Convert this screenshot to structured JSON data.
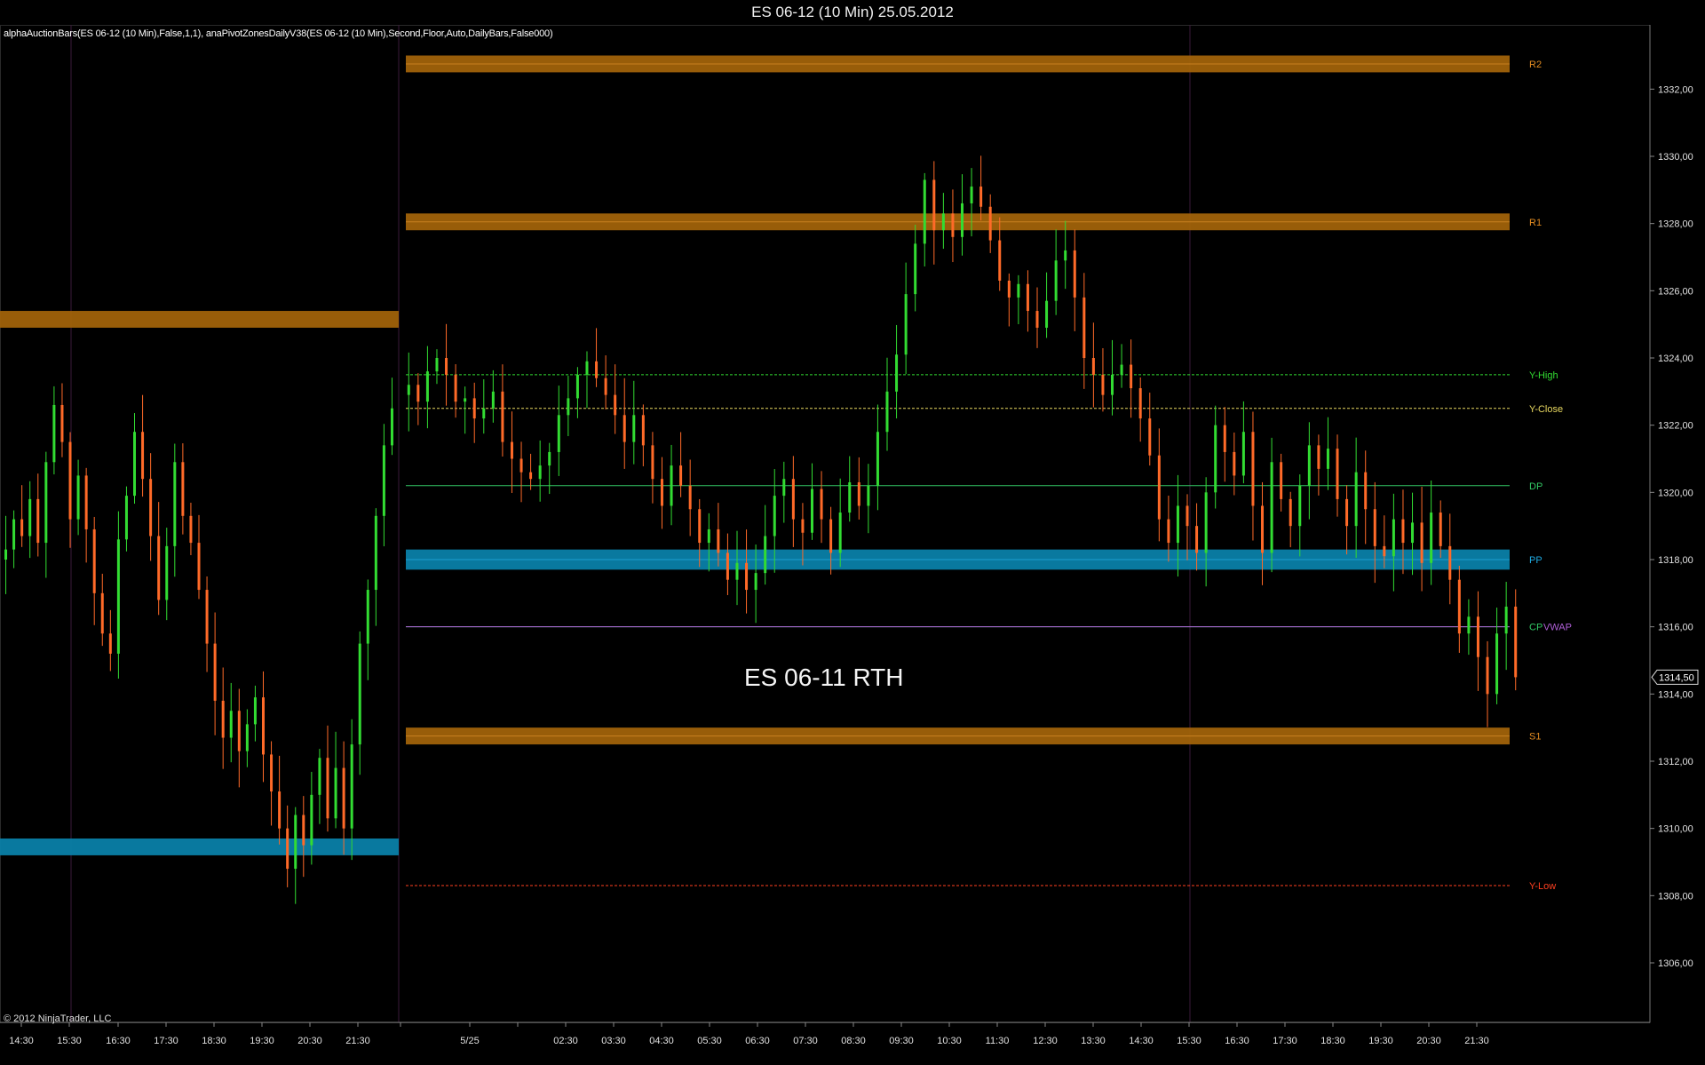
{
  "window": {
    "title": "ES 06-12 (10 Min)  25.05.2012"
  },
  "indicator_label": "alphaAuctionBars(ES 06-12 (10 Min),False,1,1), anaPivotZonesDailyV38(ES 06-12 (10 Min),Second,Floor,Auto,DailyBars,False000)",
  "copyright": "© 2012 NinjaTrader, LLC",
  "annotation": "ES 06-11 RTH",
  "colors": {
    "background": "#000000",
    "up_candle": "#32dc32",
    "down_candle": "#ff6a28",
    "resistance_zone": "#a0620a",
    "pivot_zone": "#0a80a8",
    "axis_text": "#e0e0e0"
  },
  "chart_data": {
    "type": "candlestick",
    "instrument": "ES 06-12",
    "interval": "10 Min",
    "y_axis": {
      "min": 1304,
      "max": 1334,
      "ticks": [
        "1306,00",
        "1308,00",
        "1310,00",
        "1312,00",
        "1314,00",
        "1316,00",
        "1318,00",
        "1320,00",
        "1322,00",
        "1324,00",
        "1326,00",
        "1328,00",
        "1330,00",
        "1332,00"
      ],
      "last_price": "1314,50"
    },
    "x_axis": {
      "ticks": [
        "14:30",
        "15:30",
        "16:30",
        "17:30",
        "18:30",
        "19:30",
        "20:30",
        "21:30",
        "5/25",
        "02:30",
        "03:30",
        "04:30",
        "05:30",
        "06:30",
        "07:30",
        "08:30",
        "09:30",
        "10:30",
        "11:30",
        "12:30",
        "13:30",
        "14:30",
        "15:30",
        "16:30",
        "17:30",
        "18:30",
        "19:30",
        "20:30",
        "21:30"
      ]
    },
    "zones": [
      {
        "name": "R2",
        "low": 1332.5,
        "high": 1333.0,
        "color": "#a0620a"
      },
      {
        "name": "R1",
        "low": 1327.8,
        "high": 1328.3,
        "color": "#a0620a"
      },
      {
        "name": "PP",
        "low": 1317.7,
        "high": 1318.3,
        "color": "#0a80a8"
      },
      {
        "name": "S1",
        "low": 1312.5,
        "high": 1313.0,
        "color": "#a0620a"
      }
    ],
    "prior_zones": [
      {
        "low": 1324.9,
        "high": 1325.4,
        "color": "#a0620a"
      },
      {
        "low": 1309.2,
        "high": 1309.7,
        "color": "#0a80a8"
      }
    ],
    "lines": [
      {
        "name": "Y-High",
        "value": 1323.5,
        "color": "#32dc32",
        "style": "dashed"
      },
      {
        "name": "Y-Close",
        "value": 1322.5,
        "color": "#e8d860",
        "style": "dashed"
      },
      {
        "name": "DP",
        "value": 1320.2,
        "color": "#32c864",
        "style": "solid"
      },
      {
        "name": "CP",
        "value": 1316.0,
        "color": "#32c864",
        "style": "solid"
      },
      {
        "name": "VWAP",
        "value": 1316.0,
        "color": "#b060d8",
        "style": "solid"
      },
      {
        "name": "Y-Low",
        "value": 1308.3,
        "color": "#ff4020",
        "style": "dashed"
      }
    ],
    "prior_session": [
      1318.3,
      1319.2,
      1318.7,
      1319.8,
      1318.5,
      1320.9,
      1322.6,
      1321.5,
      1319.2,
      1320.5,
      1318.9,
      1317.0,
      1315.8,
      1315.2,
      1318.6,
      1319.9,
      1321.8,
      1320.4,
      1318.7,
      1316.8,
      1318.4,
      1320.9,
      1319.3,
      1318.5,
      1317.1,
      1315.5,
      1313.8,
      1312.7,
      1313.5,
      1312.3,
      1313.1,
      1313.9,
      1312.2,
      1311.1,
      1310.0,
      1308.8,
      1310.4,
      1309.5,
      1311.0,
      1312.1,
      1310.3,
      1311.8,
      1310.0,
      1312.5,
      1315.5,
      1317.1,
      1319.3,
      1321.4,
      1322.5
    ],
    "current_session": [
      1323.2,
      1322.7,
      1323.6,
      1324.0,
      1323.5,
      1322.7,
      1322.8,
      1322.2,
      1322.5,
      1323.0,
      1321.5,
      1321.0,
      1320.6,
      1320.4,
      1320.8,
      1321.2,
      1322.3,
      1322.8,
      1323.5,
      1323.9,
      1323.4,
      1322.9,
      1322.3,
      1321.5,
      1322.3,
      1321.4,
      1320.4,
      1319.6,
      1320.8,
      1320.2,
      1319.5,
      1318.5,
      1318.9,
      1318.2,
      1317.4,
      1317.9,
      1317.1,
      1317.6,
      1318.7,
      1319.9,
      1320.4,
      1319.2,
      1318.8,
      1320.1,
      1319.2,
      1318.2,
      1319.4,
      1320.3,
      1319.6,
      1320.2,
      1321.8,
      1323.0,
      1324.1,
      1325.9,
      1327.4,
      1329.3,
      1327.8,
      1328.3,
      1327.6,
      1328.6,
      1329.1,
      1328.5,
      1327.5,
      1326.3,
      1325.8,
      1326.2,
      1325.4,
      1324.9,
      1325.7,
      1326.9,
      1327.2,
      1325.8,
      1324.0,
      1323.5,
      1322.9,
      1323.5,
      1323.8,
      1323.1,
      1322.2,
      1321.1,
      1319.2,
      1318.5,
      1319.6,
      1319.0,
      1318.2,
      1320.0,
      1322.0,
      1321.2,
      1320.5,
      1321.8,
      1319.6,
      1318.2,
      1320.9,
      1319.8,
      1319.0,
      1320.2,
      1321.4,
      1320.7,
      1321.3,
      1319.8,
      1319.0,
      1320.6,
      1319.5,
      1318.4,
      1318.1,
      1319.2,
      1318.5,
      1319.1,
      1317.9,
      1319.4,
      1318.4,
      1317.4,
      1315.8,
      1316.3,
      1315.1,
      1314.0,
      1315.8,
      1316.6,
      1314.5
    ]
  }
}
